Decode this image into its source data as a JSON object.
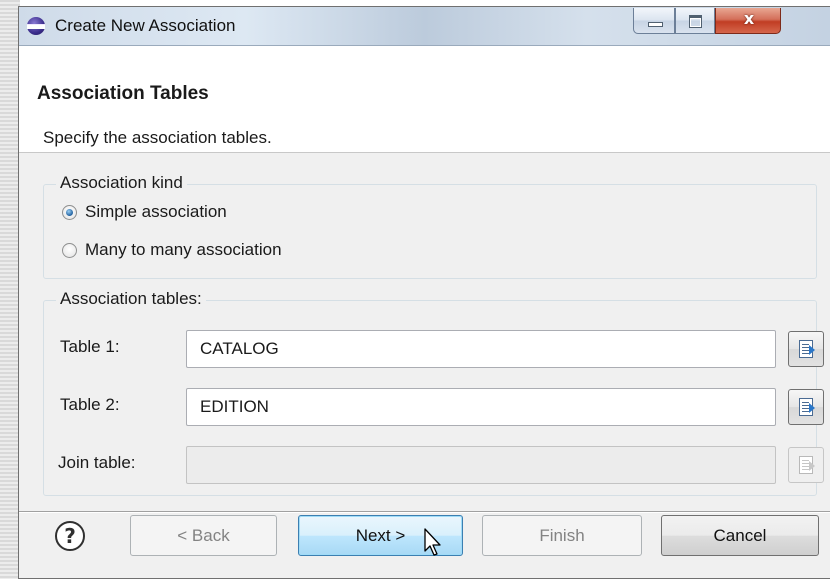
{
  "window": {
    "title": "Create New Association",
    "controls": {
      "minimize": "minimize",
      "maximize": "maximize",
      "close": "x"
    }
  },
  "header": {
    "title": "Association Tables",
    "description": "Specify the association tables."
  },
  "association_kind": {
    "legend": "Association kind",
    "options": [
      {
        "label": "Simple association",
        "selected": true
      },
      {
        "label": "Many to many association",
        "selected": false
      }
    ]
  },
  "association_tables": {
    "legend": "Association tables:",
    "fields": [
      {
        "label": "Table 1:",
        "value": "CATALOG",
        "enabled": true
      },
      {
        "label": "Table 2:",
        "value": "EDITION",
        "enabled": true
      },
      {
        "label": "Join table:",
        "value": "",
        "enabled": false
      }
    ]
  },
  "footer": {
    "help_glyph": "?",
    "back_label": "< Back",
    "next_label": "Next >",
    "finish_label": "Finish",
    "cancel_label": "Cancel"
  },
  "colors": {
    "dialog_background": "#f0f0f0",
    "default_button_border": "#3c7fb1",
    "close_button": "#c13d24"
  },
  "icons": {
    "app": "eclipse-icon",
    "browse": "browse-table-icon",
    "help": "help-icon",
    "cursor": "mouse-pointer"
  }
}
